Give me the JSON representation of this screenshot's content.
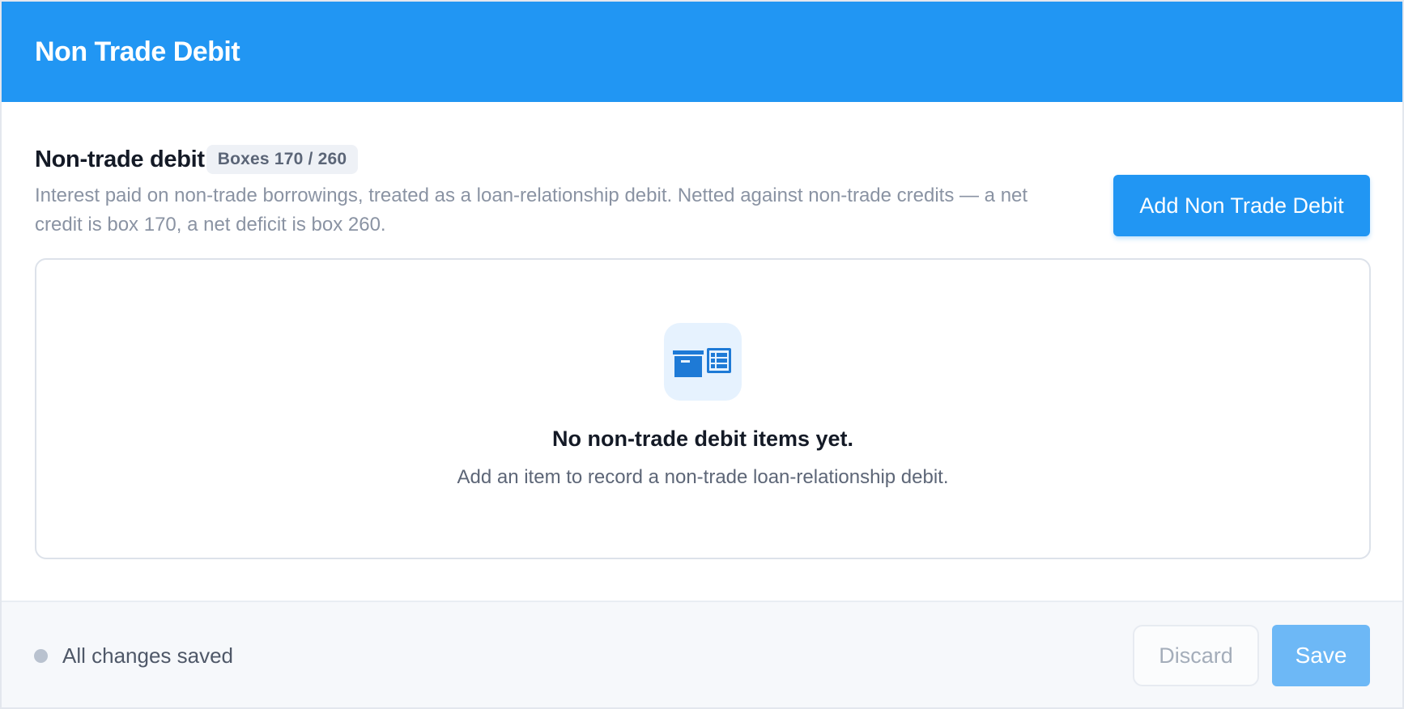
{
  "header": {
    "title": "Non Trade Debit"
  },
  "section": {
    "title": "Non-trade debit",
    "badge": "Boxes 170 / 260",
    "description": "Interest paid on non-trade borrowings, treated as a loan-relationship debit. Netted against non-trade credits — a net credit is box 170, a net deficit is box 260.",
    "add_label": "Add Non Trade Debit"
  },
  "empty_state": {
    "icon": "archive-table-icon",
    "title": "No non-trade debit items yet.",
    "subtitle": "Add an item to record a non-trade loan-relationship debit."
  },
  "footer": {
    "status_text": "All changes saved",
    "discard_label": "Discard",
    "save_label": "Save"
  },
  "colors": {
    "accent": "#2196f3",
    "accent_light": "#e6f2fe",
    "save_disabled": "#6db8f6"
  }
}
